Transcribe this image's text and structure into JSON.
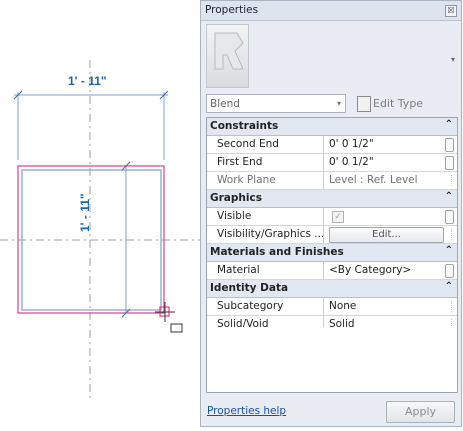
{
  "canvas": {
    "dim_horizontal": "1' - 11\"",
    "dim_vertical": "1' - 11\""
  },
  "palette": {
    "title": "Properties",
    "close_glyph": "☒",
    "type_selector": "Blend",
    "edit_type_label": "Edit Type",
    "help_link": "Properties help",
    "apply_label": "Apply"
  },
  "groups": [
    {
      "label": "Constraints",
      "rows": [
        {
          "name": "Second End",
          "value": "0'  0 1/2\""
        },
        {
          "name": "First End",
          "value": "0'  0 1/2\""
        },
        {
          "name": "Work Plane",
          "value": "Level : Ref. Level"
        }
      ]
    },
    {
      "label": "Graphics",
      "rows": [
        {
          "name": "Visible",
          "value": "✓"
        },
        {
          "name": "Visibility/Graphics ...",
          "value": "Edit..."
        }
      ]
    },
    {
      "label": "Materials and Finishes",
      "rows": [
        {
          "name": "Material",
          "value": "<By Category>"
        }
      ]
    },
    {
      "label": "Identity Data",
      "rows": [
        {
          "name": "Subcategory",
          "value": "None"
        },
        {
          "name": "Solid/Void",
          "value": "Solid"
        }
      ]
    }
  ],
  "colors": {
    "dimension": "#1a66b3",
    "profile": "#d9418a",
    "selection": "#7d9fd4"
  }
}
